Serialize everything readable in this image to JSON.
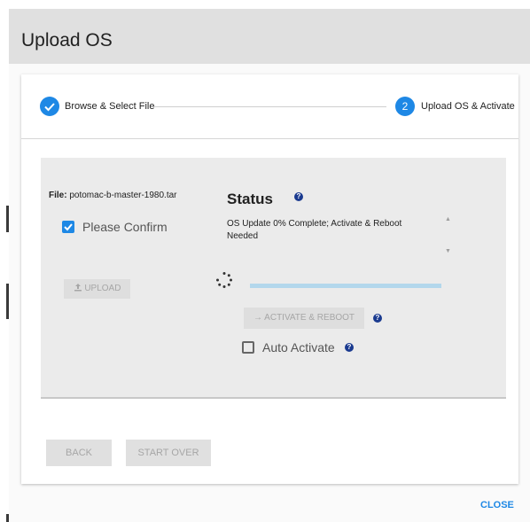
{
  "dialog": {
    "title": "Upload OS"
  },
  "stepper": {
    "step1": {
      "label": "Browse & Select File",
      "done": true
    },
    "step2": {
      "number": "2",
      "label": "Upload OS & Activate"
    }
  },
  "file": {
    "prefix": "File:",
    "name": "potomac-b-master-1980.tar"
  },
  "confirm": {
    "label": "Please Confirm",
    "checked": true
  },
  "upload_button": {
    "label": "UPLOAD",
    "icon": "upload-icon"
  },
  "status": {
    "title": "Status",
    "text": "OS Update 0% Complete; Activate & Reboot Needed",
    "progress_percent": 0
  },
  "activate_button": {
    "label": "ACTIVATE & REBOOT",
    "icon": "arrow-right-icon"
  },
  "auto_activate": {
    "label": "Auto Activate",
    "checked": false
  },
  "footer": {
    "back_label": "BACK",
    "start_over_label": "START OVER",
    "close_label": "CLOSE"
  },
  "colors": {
    "accent": "#1e88e5",
    "help": "#1a3a8f",
    "progress": "#b3d7ec"
  }
}
